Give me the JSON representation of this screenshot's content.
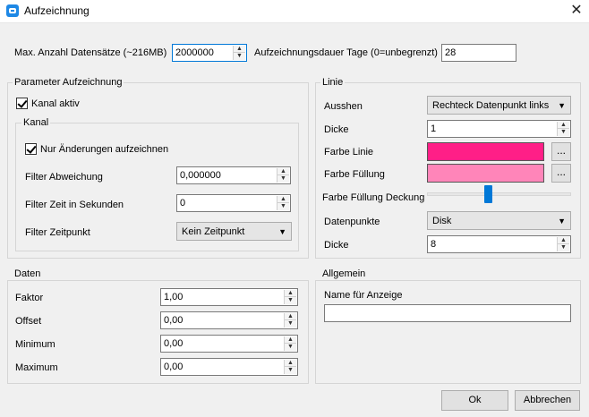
{
  "window": {
    "title": "Aufzeichnung"
  },
  "top": {
    "max_records_label": "Max. Anzahl Datensätze (~216MB)",
    "max_records_value": "2000000",
    "duration_label": "Aufzeichnungsdauer Tage (0=unbegrenzt)",
    "duration_value": "28"
  },
  "params": {
    "title": "Parameter Aufzeichnung",
    "channel_active_label": "Kanal aktiv",
    "channel_active_checked": true,
    "kanal": {
      "title": "Kanal",
      "only_changes_label": "Nur Änderungen aufzeichnen",
      "only_changes_checked": true,
      "filter_deviation_label": "Filter Abweichung",
      "filter_deviation_value": "0,000000",
      "filter_time_label": "Filter Zeit in Sekunden",
      "filter_time_value": "0",
      "filter_timepoint_label": "Filter Zeitpunkt",
      "filter_timepoint_value": "Kein Zeitpunkt"
    }
  },
  "linie": {
    "title": "Linie",
    "appearance_label": "Ausshen",
    "appearance_value": "Rechteck Datenpunkt links",
    "thickness_label": "Dicke",
    "thickness_value": "1",
    "line_color_label": "Farbe Linie",
    "line_color": "#ff1f87",
    "fill_color_label": "Farbe Füllung",
    "fill_color": "#ff85b9",
    "fill_opacity_label": "Farbe Füllung Deckung",
    "fill_opacity_level": 0.42,
    "datapoints_label": "Datenpunkte",
    "datapoints_value": "Disk",
    "point_thickness_label": "Dicke",
    "point_thickness_value": "8",
    "dots_label": "..."
  },
  "daten": {
    "title": "Daten",
    "factor_label": "Faktor",
    "factor_value": "1,00",
    "offset_label": "Offset",
    "offset_value": "0,00",
    "minimum_label": "Minimum",
    "minimum_value": "0,00",
    "maximum_label": "Maximum",
    "maximum_value": "0,00"
  },
  "allgemein": {
    "title": "Allgemein",
    "display_name_label": "Name für Anzeige",
    "display_name_value": ""
  },
  "buttons": {
    "ok": "Ok",
    "cancel": "Abbrechen"
  }
}
